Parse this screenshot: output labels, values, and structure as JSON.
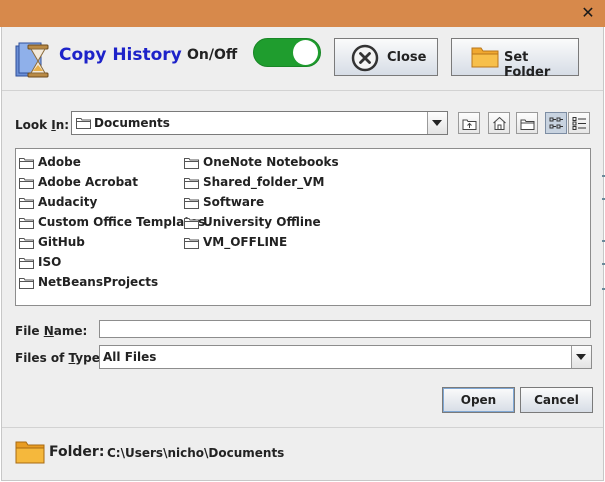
{
  "window": {
    "close_glyph": "✕"
  },
  "header": {
    "app_title": "Copy History",
    "toggle_label": "On/Off",
    "toggle_on": true,
    "close_button_label": "Close",
    "set_folder_button_label": "Set Folder"
  },
  "chooser": {
    "look_in": {
      "label_pre": "Look ",
      "label_ul": "I",
      "label_post": "n:",
      "value": "Documents"
    },
    "toolbar": [
      "up-one-level-icon",
      "home-icon",
      "new-folder-icon",
      "list-view-icon",
      "details-view-icon"
    ],
    "files_col1": [
      "Adobe",
      "Adobe Acrobat",
      "Audacity",
      "Custom Office Templates",
      "GitHub",
      "ISO",
      "NetBeansProjects"
    ],
    "files_col2": [
      "OneNote Notebooks",
      "Shared_folder_VM",
      "Software",
      "University Offline",
      "VM_OFFLINE"
    ],
    "file_name": {
      "label_pre": "File ",
      "label_ul": "N",
      "label_post": "ame:",
      "value": ""
    },
    "file_type": {
      "label_pre": "Files of ",
      "label_ul": "T",
      "label_post": "ype:",
      "value": "All Files"
    },
    "open_label": "Open",
    "cancel_label": "Cancel"
  },
  "footer": {
    "label": "Folder:",
    "path": "C:\\Users\\nicho\\Documents"
  },
  "colors": {
    "titlebar": "#d7894b",
    "title_text": "#1d22c9",
    "toggle_on": "#1f9d2e",
    "folder": "#f0a830"
  }
}
